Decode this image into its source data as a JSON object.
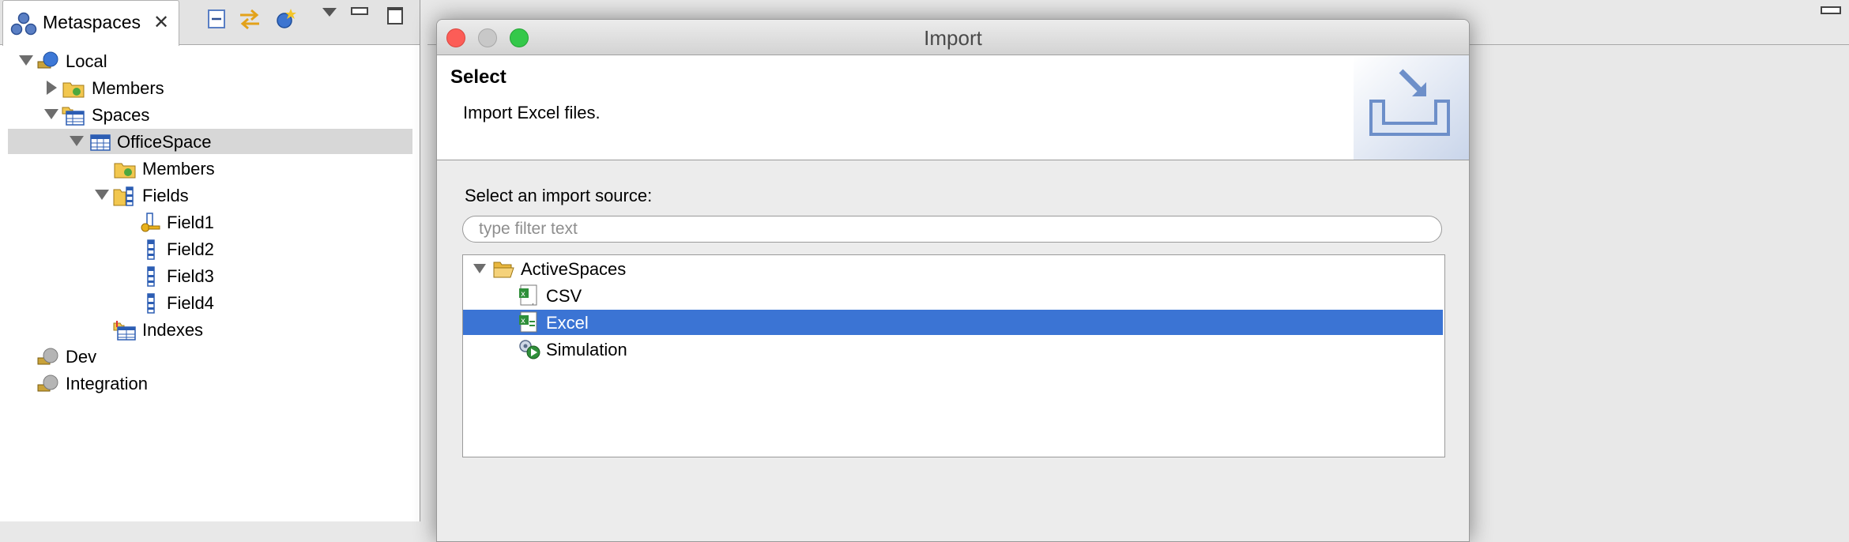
{
  "left_view": {
    "tab_label": "Metaspaces",
    "tree": [
      {
        "label": "Local",
        "twisty": "open",
        "icon": "metaspace-local-icon"
      },
      {
        "label": "Members",
        "twisty": "closed",
        "icon": "members-folder-icon"
      },
      {
        "label": "Spaces",
        "twisty": "open",
        "icon": "spaces-table-icon"
      },
      {
        "label": "OfficeSpace",
        "twisty": "open",
        "icon": "space-table-icon",
        "selected": true
      },
      {
        "label": "Members",
        "twisty": "none",
        "icon": "members-folder-icon"
      },
      {
        "label": "Fields",
        "twisty": "open",
        "icon": "fields-icon"
      },
      {
        "label": "Field1",
        "twisty": "none",
        "icon": "key-field-icon"
      },
      {
        "label": "Field2",
        "twisty": "none",
        "icon": "field-icon"
      },
      {
        "label": "Field3",
        "twisty": "none",
        "icon": "field-icon"
      },
      {
        "label": "Field4",
        "twisty": "none",
        "icon": "field-icon"
      },
      {
        "label": "Indexes",
        "twisty": "none",
        "icon": "indexes-icon"
      },
      {
        "label": "Dev",
        "twisty": "none",
        "icon": "metaspace-remote-icon"
      },
      {
        "label": "Integration",
        "twisty": "none",
        "icon": "metaspace-remote-icon"
      }
    ]
  },
  "dialog": {
    "title": "Import",
    "header_title": "Select",
    "header_description": "Import Excel files.",
    "source_label": "Select an import source:",
    "filter_placeholder": "type filter text",
    "sources": [
      {
        "label": "ActiveSpaces",
        "icon": "folder-open-icon",
        "twisty": "open"
      },
      {
        "label": "CSV",
        "icon": "csv-file-icon"
      },
      {
        "label": "Excel",
        "icon": "excel-file-icon",
        "selected": true
      },
      {
        "label": "Simulation",
        "icon": "simulation-icon"
      }
    ]
  },
  "colors": {
    "selection_blue": "#3b74d4",
    "tree_selection_gray": "#d7d7d7",
    "close_red": "#fc5d57",
    "minimize_gray": "#c8c8c8",
    "zoom_green": "#34c84a"
  }
}
